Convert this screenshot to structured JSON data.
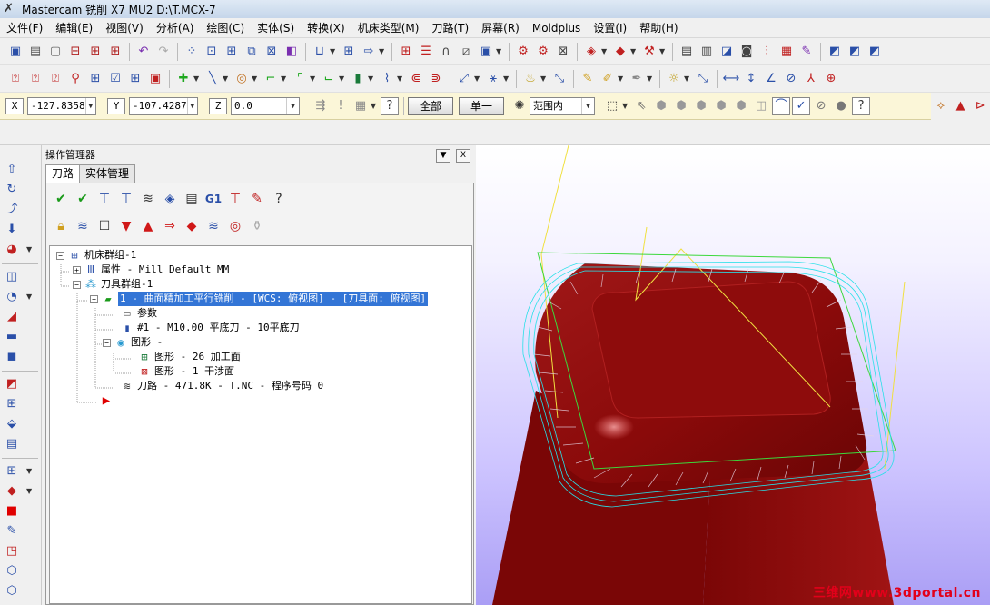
{
  "window": {
    "title": "Mastercam 铣削 X7 MU2  D:\\T.MCX-7"
  },
  "menu": [
    "文件(F)",
    "编辑(E)",
    "视图(V)",
    "分析(A)",
    "绘图(C)",
    "实体(S)",
    "转换(X)",
    "机床类型(M)",
    "刀路(T)",
    "屏幕(R)",
    "Moldplus",
    "设置(I)",
    "帮助(H)"
  ],
  "coords": {
    "x_label": "X",
    "x_value": "-127.8358",
    "y_label": "Y",
    "y_value": "-107.4287",
    "z_label": "Z",
    "z_value": "0.0",
    "all_button": "全部",
    "single_button": "单一",
    "range_select": "范围内"
  },
  "op_manager": {
    "title": "操作管理器",
    "tabs": [
      "刀路",
      "实体管理"
    ],
    "tree": {
      "machine_group": "机床群组-1",
      "properties": "属性 - Mill Default MM",
      "toolpath_group": "刀具群组-1",
      "operation": "1 - 曲面精加工平行铣削 - [WCS: 俯视图] - [刀具面: 俯视图]",
      "parameters": "参数",
      "tool": "#1 - M10.00 平底刀 - 10平底刀",
      "geometry": "图形 -",
      "geometry_drive": "图形 - 26 加工面",
      "geometry_check": "图形 - 1 干涉面",
      "toolpath": "刀路 - 471.8K - T.NC - 程序号码 0"
    }
  },
  "viewport": {
    "watermark": "三维网www.3dportal.cn"
  },
  "colors": {
    "part_red": "#8c0a0a",
    "toolpath_cyan": "#28e0e8",
    "boundary_green": "#3cd83c",
    "tool_yellow": "#f0e040",
    "selection_blue": "#3375d6",
    "coord_bar": "#fbf6d8"
  }
}
